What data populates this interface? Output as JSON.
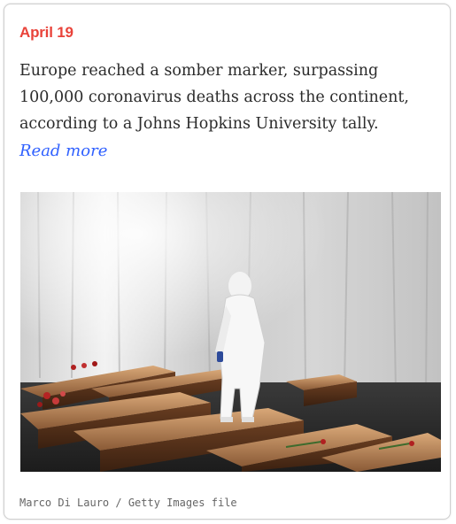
{
  "card": {
    "date": "April 19",
    "body": "Europe reached a somber marker, surpassing 100,000 coronavirus deaths across the continent, according to a Johns Hopkins University tally.",
    "read_more": "Read more",
    "photo_credit": "Marco Di Lauro / Getty Images file"
  },
  "colors": {
    "date": "#e9433a",
    "link": "#3061ff",
    "text": "#2b2b2b",
    "credit": "#666666",
    "border": "#cfcfcf"
  }
}
